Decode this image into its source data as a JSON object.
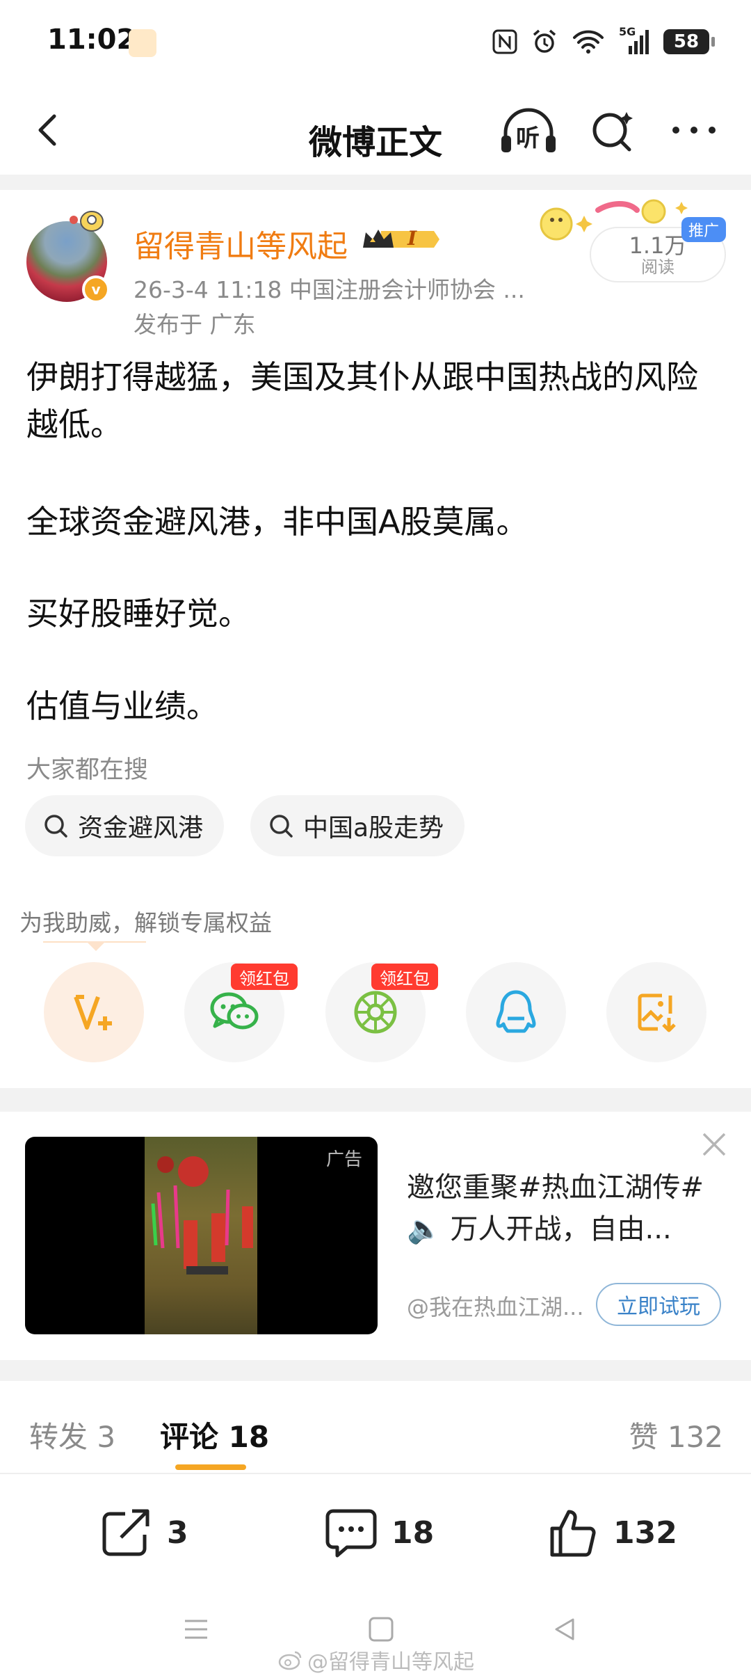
{
  "status_bar": {
    "time": "11:02",
    "network": "5G",
    "battery": "58"
  },
  "nav": {
    "title": "微博正文",
    "listen_label": "听"
  },
  "author": {
    "name": "留得青山等风起",
    "level": "I",
    "verified": "v",
    "meta": "26-3-4 11:18   中国注册会计师协会 ...",
    "location": "发布于 广东",
    "read_count": "1.1万",
    "read_label": "阅读",
    "promo_tag": "推广"
  },
  "post": {
    "paragraphs": [
      "伊朗打得越猛，美国及其仆从跟中国热战的风险越低。",
      "全球资金避风港，非中国A股莫属。",
      "买好股睡好觉。",
      "估值与业绩。"
    ]
  },
  "search": {
    "label": "大家都在搜",
    "chips": [
      "资金避风港",
      "中国a股走势"
    ]
  },
  "support": {
    "label": "为我助威，解锁专属权益",
    "redpack_tag": "领红包",
    "share_targets": [
      "v-plus-icon",
      "wechat-icon",
      "moments-icon",
      "qq-icon",
      "save-image-icon"
    ]
  },
  "ad": {
    "label": "广告",
    "title": "邀您重聚#热血江湖传#🔈 万人开战，自由...",
    "source": "@我在热血江湖...",
    "cta": "立即试玩"
  },
  "tabs": [
    {
      "label": "转发 3"
    },
    {
      "label": "评论 18"
    },
    {
      "label": "赞 132"
    }
  ],
  "actions": {
    "repost": "3",
    "comment": "18",
    "like": "132"
  },
  "watermark": "@留得青山等风起",
  "colors": {
    "accent": "#f5a623",
    "author_name": "#f07c12",
    "link": "#3a82c8"
  }
}
